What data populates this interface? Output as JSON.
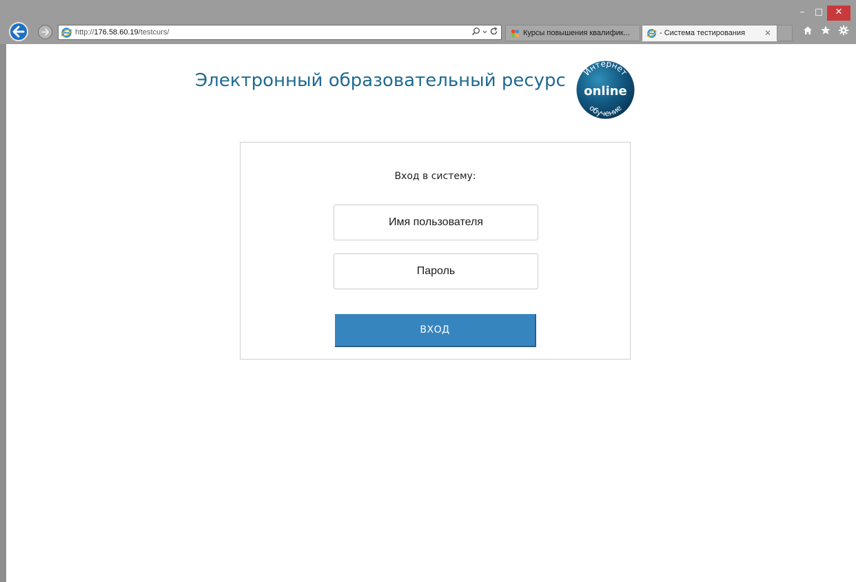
{
  "browser": {
    "url_prefix": "http://",
    "url_host": "176.58.60.19",
    "url_path": "/testcurs/",
    "tabs": [
      {
        "label": "Курсы повышения квалифик...",
        "active": false
      },
      {
        "label": "- Система тестирования",
        "active": true
      }
    ],
    "window_controls": {
      "minimize": "–",
      "maximize": "□",
      "close": "✕"
    },
    "toolbar_icons": [
      "home-icon",
      "favorites-star-icon",
      "settings-gear-icon"
    ],
    "accent_color": "#1e6fc2"
  },
  "page": {
    "site_title": "Электронный образовательный ресурс",
    "logo": {
      "top_text": "Интернет",
      "main_text": "online",
      "bottom_text": "обучение"
    },
    "login": {
      "heading": "Вход в систему:",
      "username_placeholder": "Имя пользователя",
      "password_placeholder": "Пароль",
      "submit_label": "ВХОД",
      "button_color": "#3785bf"
    }
  }
}
